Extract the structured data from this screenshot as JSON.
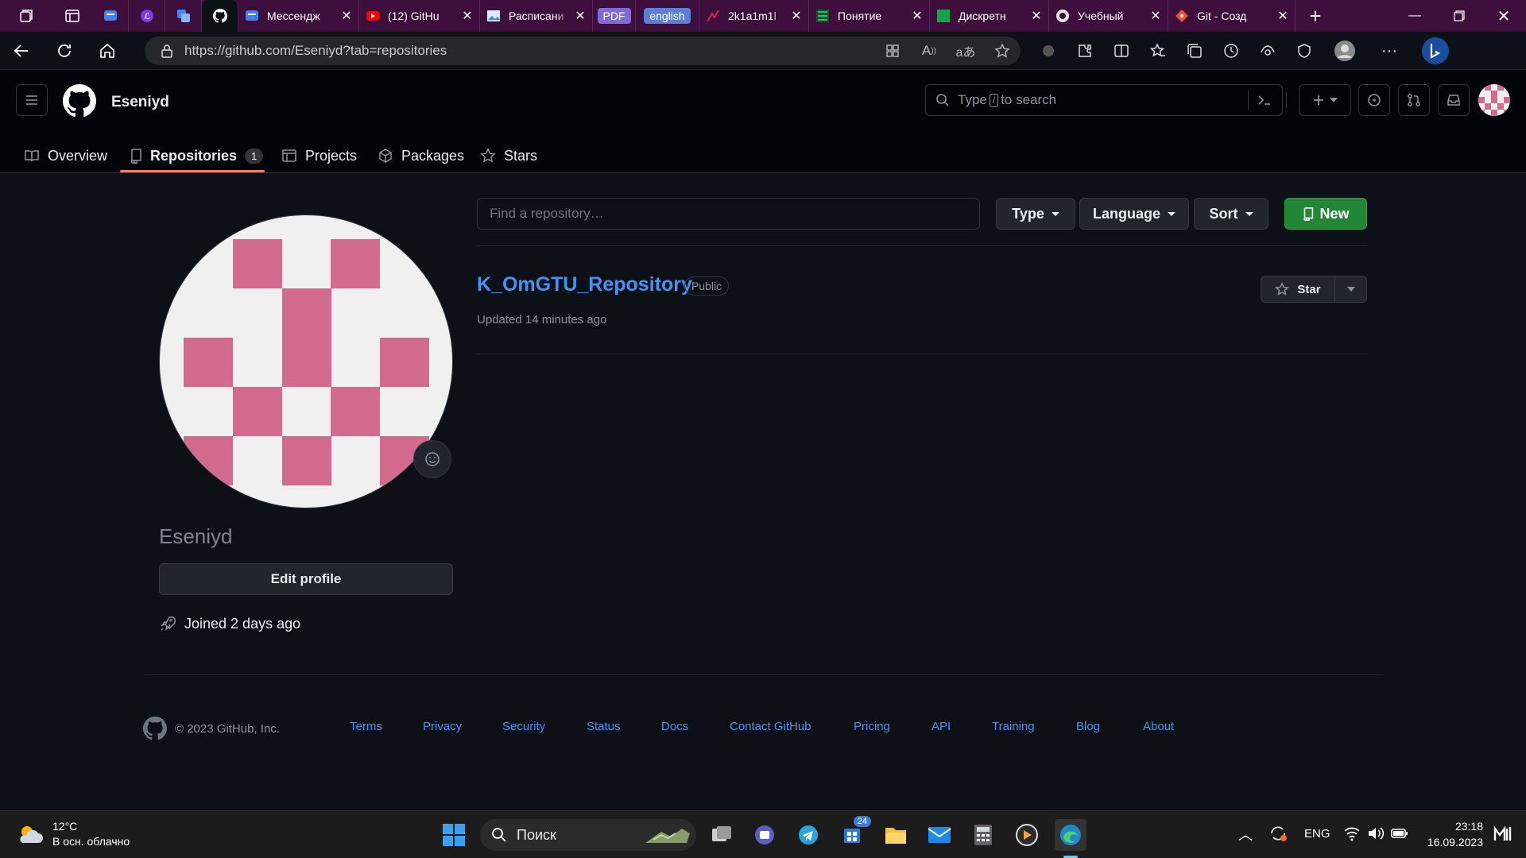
{
  "browser": {
    "tabs": [
      {
        "title": "",
        "favicon": "messenger-icon",
        "color": "#3b82f6"
      },
      {
        "title": "",
        "favicon": "letter-icon",
        "color": "#7c3aed"
      },
      {
        "title": "",
        "favicon": "translate-icon",
        "color": "#4285f4"
      },
      {
        "title": "",
        "favicon": "github-icon",
        "color": "#ffffff",
        "active": true
      },
      {
        "title": "Мессендж",
        "favicon": "messenger-icon",
        "color": "#3b82f6"
      },
      {
        "title": "(12) GitHu",
        "favicon": "youtube-icon",
        "color": "#ff0000"
      },
      {
        "title": "Расписани",
        "favicon": "image-icon",
        "color": "#60a5fa"
      },
      {
        "title": "2k1a1m1l",
        "favicon": "chart-icon",
        "color": "#e11d48"
      },
      {
        "title": "Понятие",
        "favicon": "grid-icon",
        "color": "#22c55e"
      },
      {
        "title": "Дискретн",
        "favicon": "square-icon",
        "color": "#16a34a"
      },
      {
        "title": "Учебный",
        "favicon": "globe-icon",
        "color": "#e5e5e5"
      },
      {
        "title": "Git - Созд",
        "favicon": "git-icon",
        "color": "#f05033"
      }
    ],
    "pill_pdf": "PDF",
    "pill_english": "english",
    "url": "https://github.com/Eseniyd?tab=repositories"
  },
  "github": {
    "username": "Eseniyd",
    "search_placeholder_pre": "Type",
    "search_key": "/",
    "search_placeholder_post": "to search",
    "nav": {
      "overview": "Overview",
      "repositories": "Repositories",
      "repositories_count": "1",
      "projects": "Projects",
      "packages": "Packages",
      "stars": "Stars"
    }
  },
  "profile": {
    "display_name": "Eseniyd",
    "edit_button": "Edit profile",
    "joined": "Joined 2 days ago"
  },
  "repo_list": {
    "find_placeholder": "Find a repository…",
    "type_label": "Type",
    "language_label": "Language",
    "sort_label": "Sort",
    "new_label": "New",
    "repos": [
      {
        "name": "K_OmGTU_Repository",
        "visibility": "Public",
        "updated": "Updated 14 minutes ago",
        "star_label": "Star"
      }
    ]
  },
  "footer": {
    "copyright": "© 2023 GitHub, Inc.",
    "links": [
      "Terms",
      "Privacy",
      "Security",
      "Status",
      "Docs",
      "Contact GitHub",
      "Pricing",
      "API",
      "Training",
      "Blog",
      "About"
    ]
  },
  "taskbar": {
    "weather_temp": "12°C",
    "weather_desc": "В осн. облачно",
    "search_label": "Поиск",
    "badge_count": "24",
    "language": "ENG",
    "time": "23:18",
    "date": "16.09.2023"
  },
  "colors": {
    "accent_green": "#238636",
    "link_blue": "#4493f8",
    "tab_bar": "#3e0f3c",
    "identicon_pink": "#d26b8e"
  }
}
